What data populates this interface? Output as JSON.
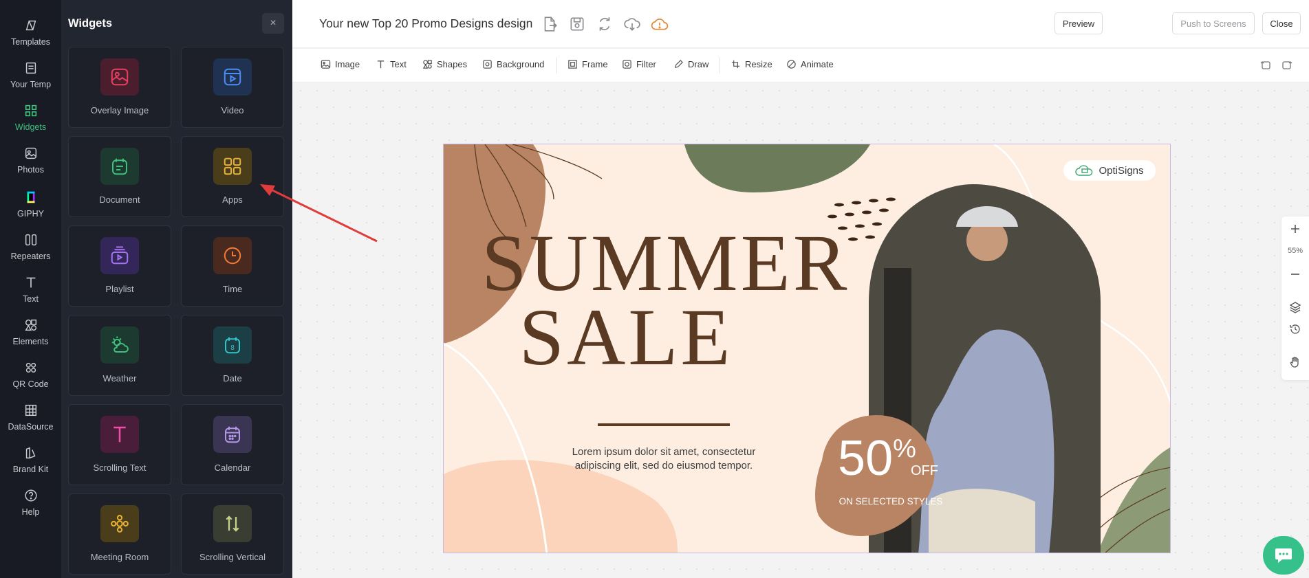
{
  "rail": {
    "items": [
      {
        "label": "Templates",
        "icon": "templates-icon"
      },
      {
        "label": "Your Temp",
        "icon": "your-templates-icon"
      },
      {
        "label": "Widgets",
        "icon": "widgets-icon",
        "active": true
      },
      {
        "label": "Photos",
        "icon": "photos-icon"
      },
      {
        "label": "GIPHY",
        "icon": "giphy-icon"
      },
      {
        "label": "Repeaters",
        "icon": "repeaters-icon"
      },
      {
        "label": "Text",
        "icon": "text-icon"
      },
      {
        "label": "Elements",
        "icon": "elements-icon"
      },
      {
        "label": "QR Code",
        "icon": "qr-code-icon"
      },
      {
        "label": "DataSource",
        "icon": "datasource-icon"
      },
      {
        "label": "Brand Kit",
        "icon": "brand-kit-icon"
      },
      {
        "label": "Help",
        "icon": "help-icon"
      }
    ]
  },
  "panel": {
    "title": "Widgets",
    "close": "×",
    "widgets": [
      {
        "label": "Overlay Image",
        "icon": "overlay-image-icon",
        "color": "#e4405f",
        "bg": "#4a1e2c"
      },
      {
        "label": "Video",
        "icon": "video-icon",
        "color": "#4d8df0",
        "bg": "#1f3252"
      },
      {
        "label": "Document",
        "icon": "document-icon",
        "color": "#3fc07b",
        "bg": "#1d3a30"
      },
      {
        "label": "Apps",
        "icon": "apps-icon",
        "color": "#e8b23a",
        "bg": "#4a3e1a"
      },
      {
        "label": "Playlist",
        "icon": "playlist-icon",
        "color": "#a774f0",
        "bg": "#33275a"
      },
      {
        "label": "Time",
        "icon": "time-icon",
        "color": "#f07a3a",
        "bg": "#4a2a1e"
      },
      {
        "label": "Weather",
        "icon": "weather-icon",
        "color": "#3fc07b",
        "bg": "#1d3a30"
      },
      {
        "label": "Date",
        "icon": "date-icon",
        "color": "#34c3c9",
        "bg": "#1b3f44"
      },
      {
        "label": "Scrolling Text",
        "icon": "scrolling-text-icon",
        "color": "#f04fa8",
        "bg": "#4a1e3a"
      },
      {
        "label": "Calendar",
        "icon": "calendar-icon",
        "color": "#b597ea",
        "bg": "#3a3552"
      },
      {
        "label": "Meeting Room",
        "icon": "meeting-room-icon",
        "color": "#e8b23a",
        "bg": "#4a3e1a"
      },
      {
        "label": "Scrolling Vertical",
        "icon": "scrolling-vertical-icon",
        "color": "#c6d18a",
        "bg": "#3a3d32"
      }
    ]
  },
  "topbar": {
    "title": "Your new Top 20 Promo Designs design",
    "preview": "Preview",
    "push": "Push to Screens",
    "close": "Close"
  },
  "toolbar": {
    "tools": [
      "Image",
      "Text",
      "Shapes",
      "Background",
      "Frame",
      "Filter",
      "Draw",
      "Resize",
      "Animate"
    ]
  },
  "design": {
    "logo": "OptiSigns",
    "line1": "SUMMER",
    "line2": "SALE",
    "body": "Lorem ipsum dolor sit amet, consectetur adipiscing elit, sed do eiusmod tempor.",
    "pct": "50",
    "pct_sign": "%",
    "off": "OFF",
    "sub": "ON SELECTED STYLES"
  },
  "zoom": {
    "level": "55%"
  },
  "colors": {
    "accent": "#3fc07b",
    "annotation_arrow": "#e03c3c",
    "chat": "#37c18a"
  }
}
